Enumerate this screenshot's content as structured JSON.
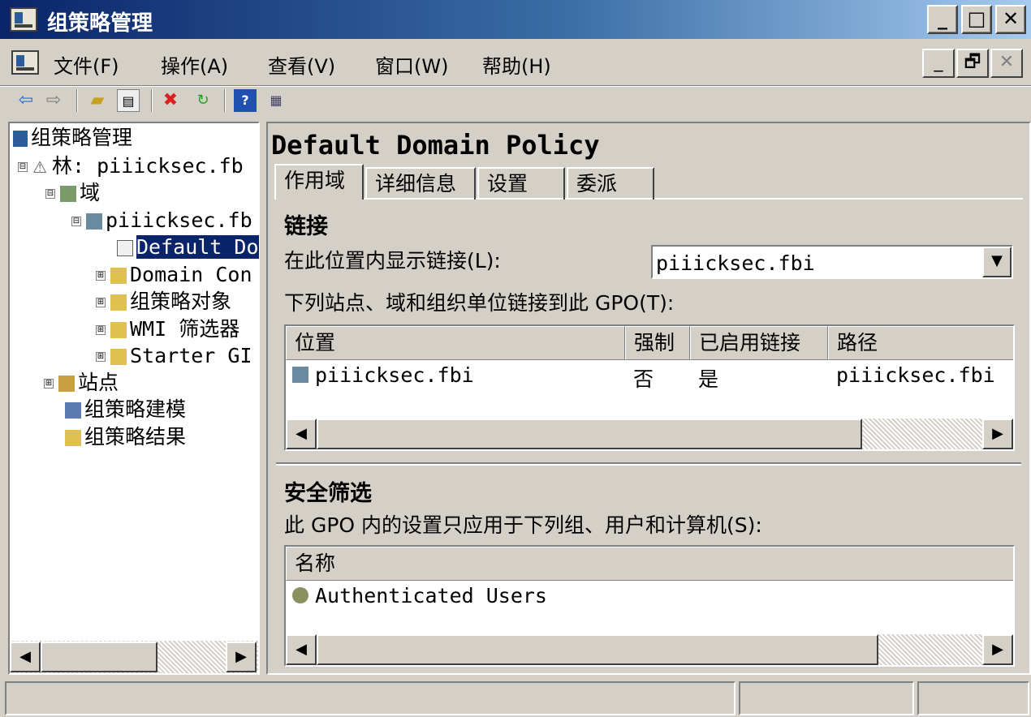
{
  "window": {
    "title": "组策略管理",
    "buttons": {
      "minimize": "_",
      "maximize": "□",
      "close": "✕"
    }
  },
  "menu": {
    "items": [
      "文件(F)",
      "操作(A)",
      "查看(V)",
      "窗口(W)",
      "帮助(H)"
    ],
    "mdi_buttons": {
      "minimize": "_",
      "restore": "🗗",
      "close": "✕"
    }
  },
  "toolbar": {
    "icons": [
      "back-arrow-icon",
      "forward-arrow-icon",
      "up-folder-icon",
      "show-hide-tree-icon",
      "delete-icon",
      "refresh-icon",
      "help-icon",
      "properties-icon"
    ]
  },
  "tree": {
    "root": "组策略管理",
    "forest": "林: piiicksec.fb",
    "domains": "域",
    "domain": "piiicksec.fb",
    "gpo_selected": "Default Do",
    "domain_controllers": "Domain Con",
    "gpo_objects": "组策略对象",
    "wmi_filters": "WMI 筛选器",
    "starter_gpos": "Starter GI",
    "sites": "站点",
    "modeling": "组策略建模",
    "results": "组策略结果",
    "toggle_minus": "⊟",
    "toggle_plus": "⊞"
  },
  "details": {
    "heading": "Default Domain Policy",
    "tabs": [
      "作用域",
      "详细信息",
      "设置",
      "委派"
    ],
    "links": {
      "section_title": "链接",
      "display_label": "在此位置内显示链接(L):",
      "dropdown_value": "piiicksec.fbi",
      "linked_label": "下列站点、域和组织单位链接到此 GPO(T):",
      "columns": [
        "位置",
        "强制",
        "已启用链接",
        "路径"
      ],
      "rows": [
        {
          "location": "piiicksec.fbi",
          "enforced": "否",
          "enabled": "是",
          "path": "piiicksec.fbi"
        }
      ]
    },
    "security": {
      "section_title": "安全筛选",
      "description": "此 GPO 内的设置只应用于下列组、用户和计算机(S):",
      "columns": [
        "名称"
      ],
      "rows": [
        {
          "name": "Authenticated Users"
        }
      ]
    }
  },
  "scroll": {
    "left": "◀",
    "right": "▶",
    "down": "▼"
  },
  "colors": {
    "title_start": "#0a246a",
    "title_end": "#a6caf0",
    "selection": "#0a246a",
    "face": "#d4d0c8"
  }
}
